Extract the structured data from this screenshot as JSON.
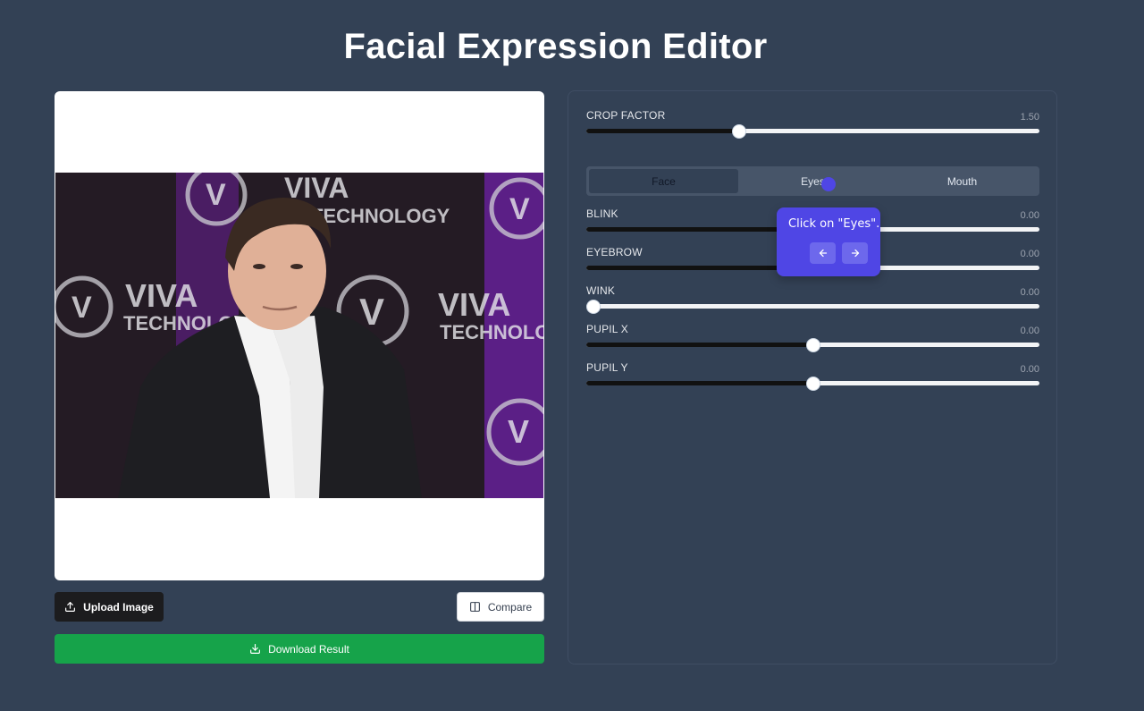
{
  "page": {
    "title": "Facial Expression Editor"
  },
  "buttons": {
    "upload_label": "Upload Image",
    "compare_label": "Compare",
    "download_label": "Download Result"
  },
  "crop_factor": {
    "label": "CROP FACTOR",
    "value": "1.50",
    "fraction": 0.338
  },
  "tabs": {
    "items": [
      {
        "label": "Face",
        "active": true
      },
      {
        "label": "Eyes",
        "active": false
      },
      {
        "label": "Mouth",
        "active": false
      }
    ]
  },
  "sliders": [
    {
      "label": "BLINK",
      "value": "0.00",
      "fraction": 0.5
    },
    {
      "label": "EYEBROW",
      "value": "0.00",
      "fraction": 0.5
    },
    {
      "label": "WINK",
      "value": "0.00",
      "fraction": 0.0
    },
    {
      "label": "PUPIL X",
      "value": "0.00",
      "fraction": 0.5
    },
    {
      "label": "PUPIL Y",
      "value": "0.00",
      "fraction": 0.5
    }
  ],
  "tooltip": {
    "text": "Click on \"Eyes\".",
    "prev_icon": "arrow-left-icon",
    "next_icon": "arrow-right-icon"
  },
  "image": {
    "banner_text_1": "VIVA",
    "banner_text_2": "TECHNOLOGY",
    "logo_letter": "V"
  },
  "colors": {
    "background": "#334155",
    "download": "#16a34a",
    "tooltip": "#4f46e5"
  }
}
